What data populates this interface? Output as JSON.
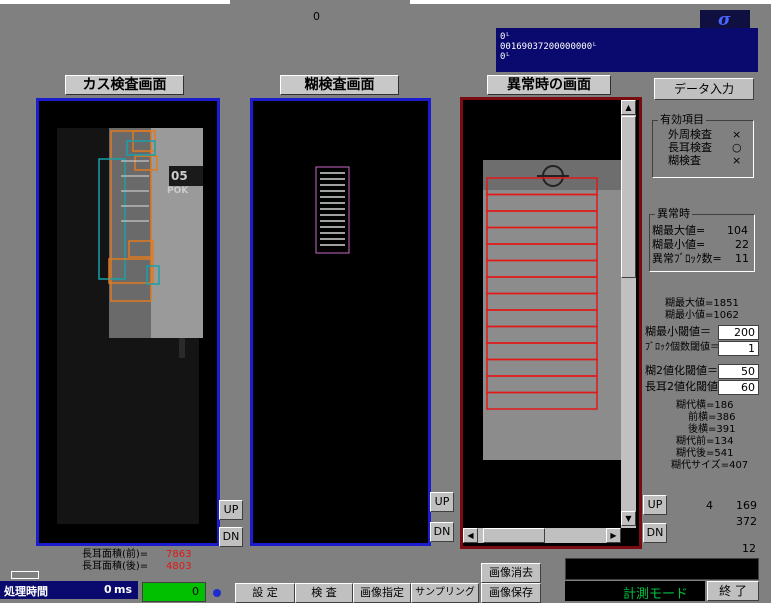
{
  "top": {
    "counter": "0"
  },
  "log_box": {
    "lines": [
      "0ᴸ",
      "00169037200000000ᴸ",
      "0ᴸ"
    ]
  },
  "panels": {
    "left_title": "カス検査画面",
    "center_title": "糊検査画面",
    "right_title": "異常時の画面"
  },
  "buttons": {
    "data_input": "データ入力",
    "up": "UP",
    "dn": "DN",
    "settings": "設 定",
    "inspection": "検 査",
    "image_select": "画像指定",
    "sampling": "サンプリング",
    "image_save": "画像保存",
    "image_clear": "画像消去",
    "exit": "終 了"
  },
  "valid_items": {
    "title": "有効項目",
    "rows": [
      {
        "label": "外周検査",
        "mark": "×"
      },
      {
        "label": "長耳検査",
        "mark": "○"
      },
      {
        "label": "糊検査",
        "mark": "×"
      }
    ]
  },
  "anomaly": {
    "title": "異常時",
    "rows": [
      {
        "label": "糊最大値=",
        "value": "104"
      },
      {
        "label": "糊最小値=",
        "value": "22"
      },
      {
        "label": "異常ﾌﾞﾛｯｸ数=",
        "value": "11"
      }
    ]
  },
  "stats": {
    "glue_max": "糊最大値=1851",
    "glue_min": "糊最小値=1062"
  },
  "thresholds": [
    {
      "label": "糊最小閾値＝",
      "value": "200"
    },
    {
      "label": "ﾌﾞﾛｯｸ個数閾値＝",
      "value": "1"
    },
    {
      "label": "糊2値化閾値＝",
      "value": "50"
    },
    {
      "label": "長耳2値化閾値＝",
      "value": "60"
    }
  ],
  "dims": [
    "糊代横=186",
    "前横=386",
    "後横=391",
    "糊代前=134",
    "糊代後=541",
    "糊代サイズ=407"
  ],
  "side_numbers": {
    "n4": "4",
    "n169": "169",
    "n372": "372",
    "n12": "12"
  },
  "ear_area": {
    "front_label": "長耳面積(前)=",
    "front_value": "7863",
    "back_label": "長耳面積(後)=",
    "back_value": "4803"
  },
  "processing": {
    "label": "処理時間",
    "value": "0",
    "unit": "ms"
  },
  "green_counter": "0",
  "mode": "計測モード",
  "colors": {
    "panel_blue": "#1c1ccf",
    "panel_red": "#7a0b10",
    "rect_orange": "#e07a20",
    "rect_red": "#e01818",
    "status_green": "#00c000"
  }
}
